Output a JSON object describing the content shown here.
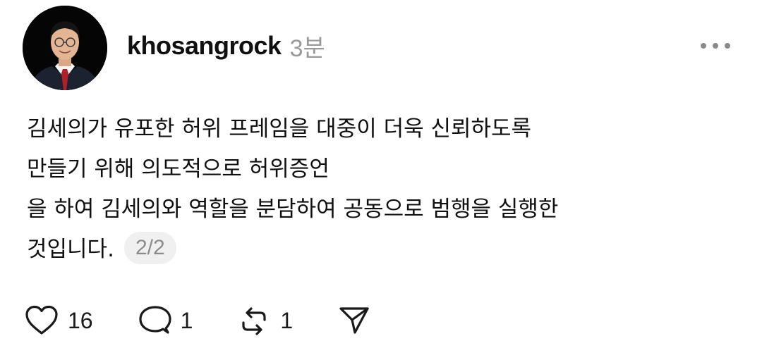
{
  "post": {
    "username": "khosangrock",
    "timestamp": "3분",
    "avatar_icon": "profile-photo-man-in-suit",
    "more_icon": "ellipsis-icon",
    "text_lines": [
      "김세의가 유포한 허위 프레임을 대중이 더욱 신뢰하도록",
      "만들기 위해 의도적으로 허위증언",
      "을 하여 김세의와 역할을 분담하여 공동으로 범행을 실행한",
      "것입니다."
    ],
    "page_indicator": "2/2"
  },
  "actions": {
    "like": {
      "icon": "heart-icon",
      "count": "16"
    },
    "reply": {
      "icon": "comment-icon",
      "count": "1"
    },
    "repost": {
      "icon": "repost-icon",
      "count": "1"
    },
    "share": {
      "icon": "send-icon"
    }
  },
  "colors": {
    "text": "#101010",
    "muted": "#9a9a9a",
    "chip_bg": "#f0f0f0"
  }
}
